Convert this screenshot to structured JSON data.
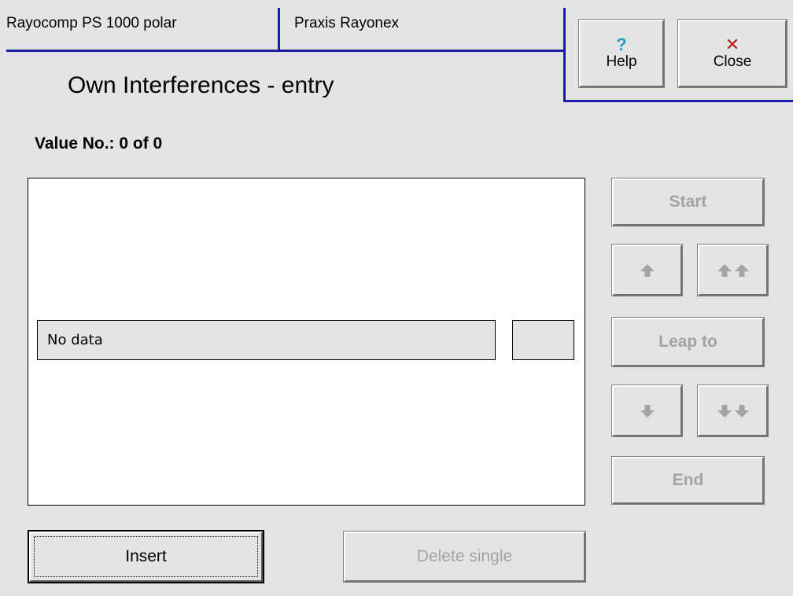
{
  "header": {
    "device_tab": "Rayocomp PS 1000 polar",
    "mode_tab": "Praxis Rayonex",
    "help_label": "Help",
    "help_glyph": "?",
    "close_label": "Close",
    "close_glyph": "✕"
  },
  "page": {
    "title": "Own Interferences - entry",
    "value_counter": "Value No.: 0 of 0"
  },
  "data_panel": {
    "field_text": "No data",
    "side_field_text": ""
  },
  "nav": {
    "start_label": "Start",
    "up_icon": "arrow-up-icon",
    "page_up_icon": "double-arrow-up-icon",
    "leap_label": "Leap to",
    "down_icon": "arrow-down-icon",
    "page_down_icon": "double-arrow-down-icon",
    "end_label": "End"
  },
  "footer": {
    "insert_label": "Insert",
    "delete_label": "Delete single"
  },
  "colors": {
    "background": "#e4e4e4",
    "frame_blue": "#1c1ca0",
    "help_icon": "#1aa0c8",
    "close_icon": "#c01818",
    "disabled_text": "#a3a3a3"
  }
}
